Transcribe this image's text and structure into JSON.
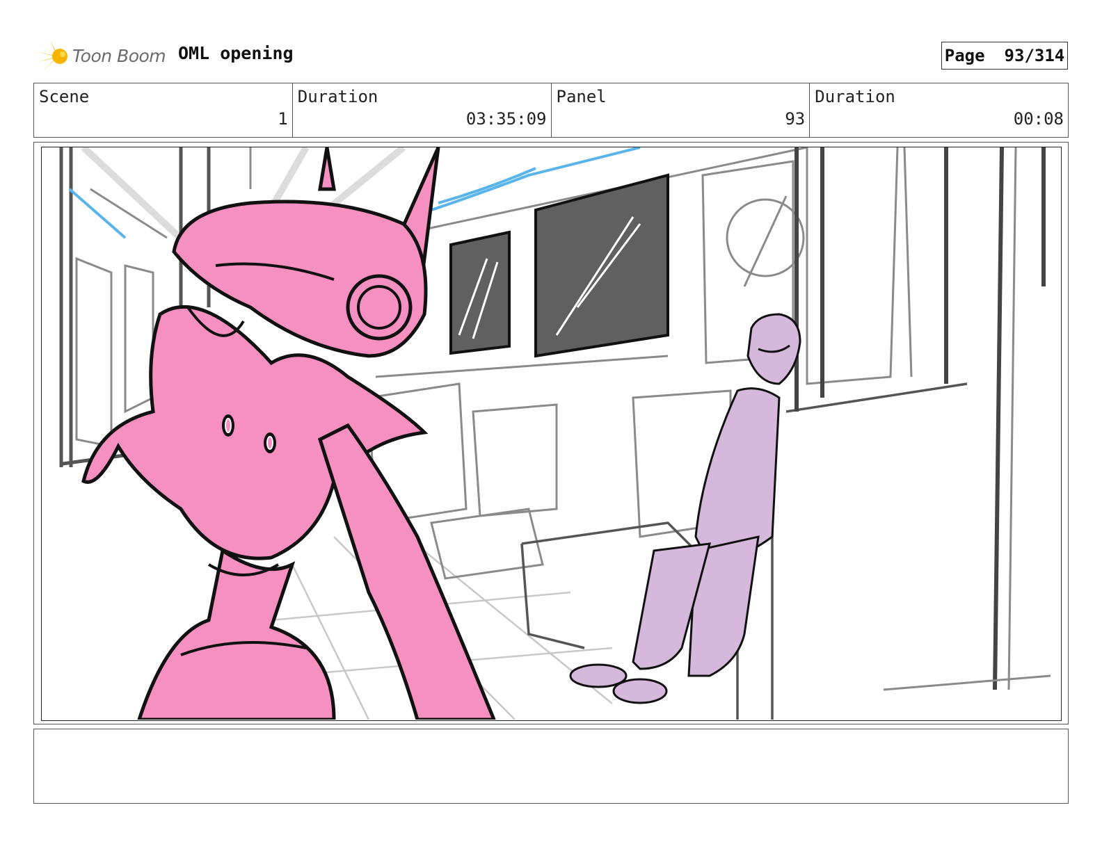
{
  "header": {
    "logo_text": "Toon Boom",
    "project_title": "OML opening",
    "page_label": "Page",
    "page_number": "93/314"
  },
  "info": {
    "scene_label": "Scene",
    "scene_value": "1",
    "scene_duration_label": "Duration",
    "scene_duration_value": "03:35:09",
    "panel_label": "Panel",
    "panel_value": "93",
    "panel_duration_label": "Duration",
    "panel_duration_value": "00:08"
  },
  "panel": {
    "image_description": "storyboard-sketch-subway-car",
    "colors": {
      "robot_fill": "#f590c0",
      "passenger_fill": "#d6b8dc",
      "window_dark": "#606060",
      "rail_blue": "#5ab4ec",
      "line_black": "#111111",
      "line_grey": "#8a8a8a"
    }
  },
  "notes": {
    "text": ""
  },
  "logo_colors": {
    "star": "#f7b500",
    "text": "#6b6b6b"
  }
}
